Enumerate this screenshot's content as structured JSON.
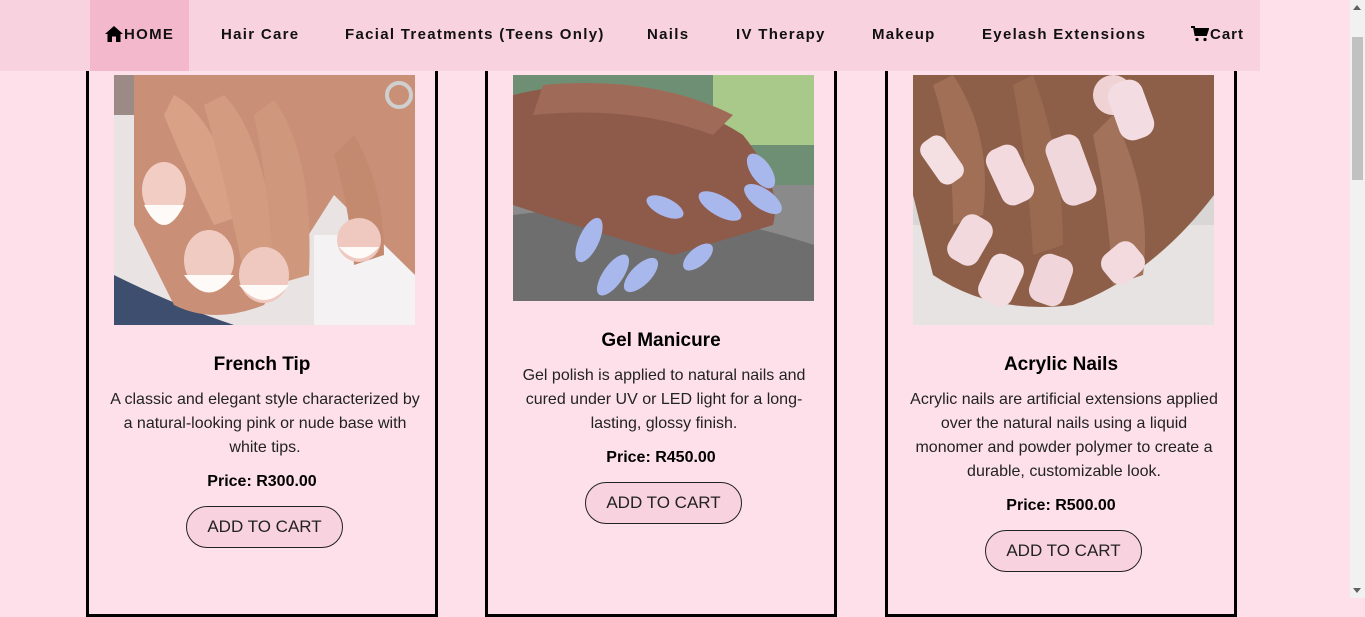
{
  "nav": {
    "items": [
      {
        "label": "HOME",
        "icon": "home-icon"
      },
      {
        "label": "Hair Care"
      },
      {
        "label": "Facial Treatments (Teens Only)"
      },
      {
        "label": "Nails"
      },
      {
        "label": "IV Therapy"
      },
      {
        "label": "Makeup"
      },
      {
        "label": "Eyelash Extensions"
      },
      {
        "label": "Cart",
        "icon": "cart-icon"
      }
    ]
  },
  "products": [
    {
      "title": "French Tip",
      "description": "A classic and elegant style characterized by a natural-looking pink or nude base with white tips.",
      "price": "Price: R300.00",
      "button": "ADD TO CART"
    },
    {
      "title": "Gel Manicure",
      "description": "Gel polish is applied to natural nails and cured under UV or LED light for a long-lasting, glossy finish.",
      "price": "Price: R450.00",
      "button": "ADD TO CART"
    },
    {
      "title": "Acrylic Nails",
      "description": "Acrylic nails are artificial extensions applied over the natural nails using a liquid monomer and powder polymer to create a durable, customizable look.",
      "price": "Price: R500.00",
      "button": "ADD TO CART"
    }
  ],
  "colors": {
    "page_bg": "#fde0ea",
    "navbar_bg": "#f9d2df",
    "active_nav_bg": "#f3b8cb",
    "button_bg": "#f9d2df"
  }
}
